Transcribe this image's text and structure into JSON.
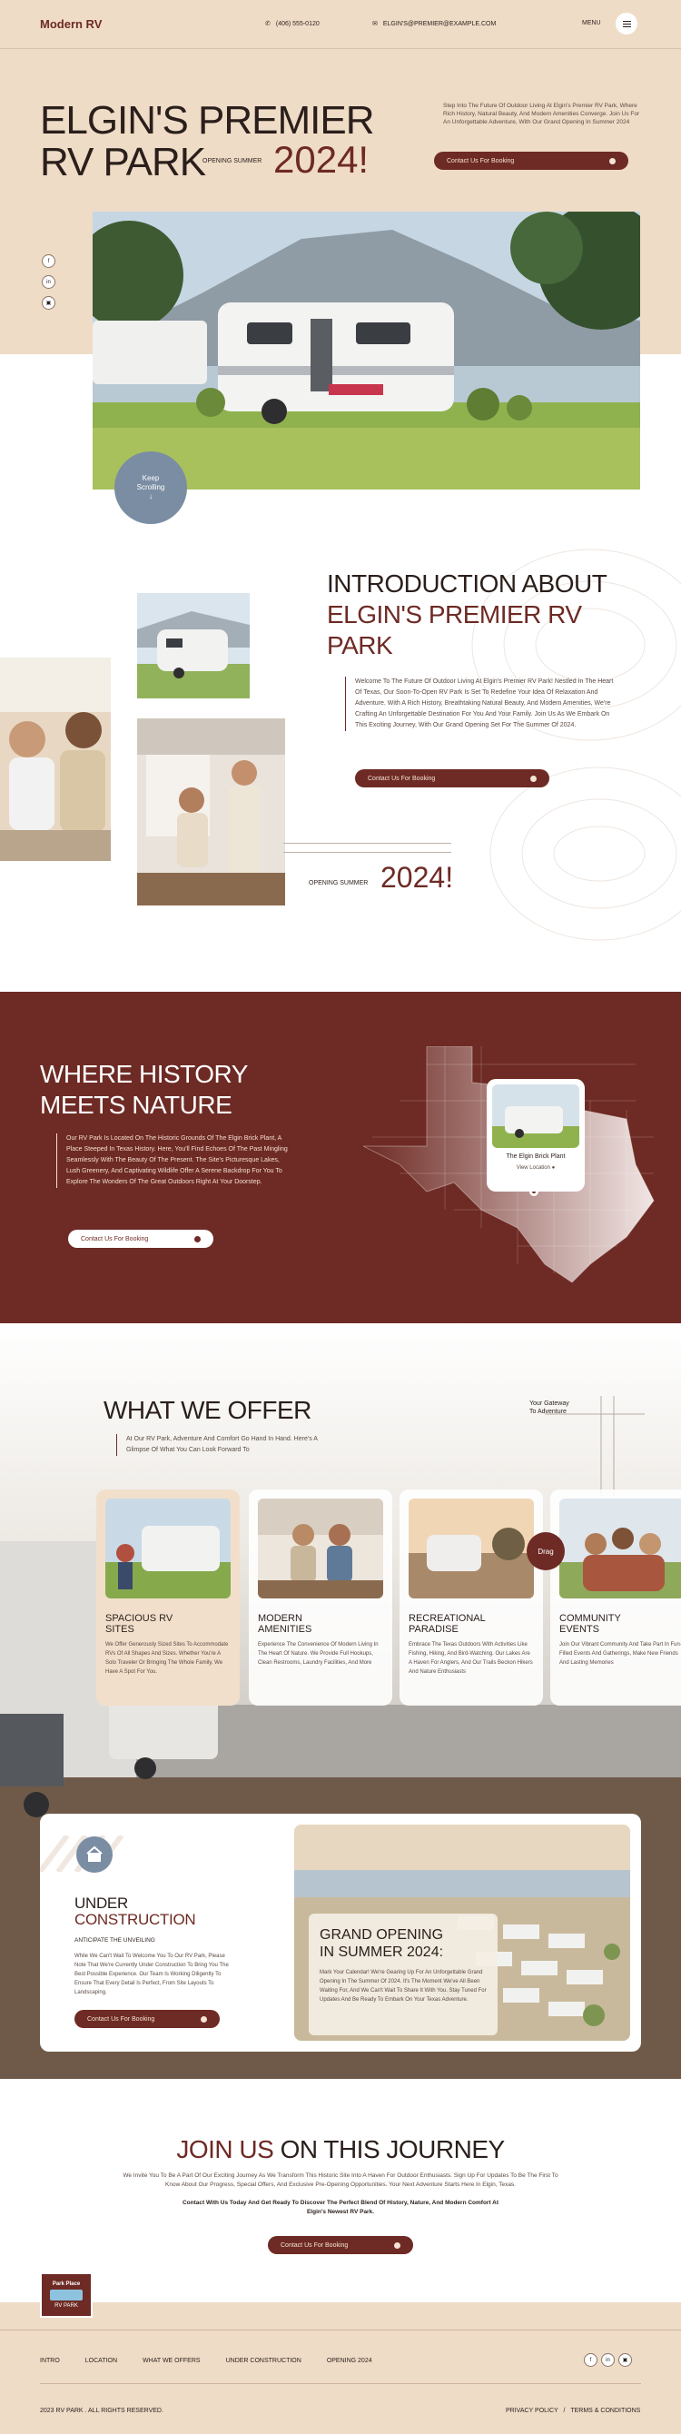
{
  "header": {
    "logo": "Modern RV",
    "phone": "(406) 555-0120",
    "email": "ELGIN'S@PREMIER@EXAMPLE.COM",
    "menu_label": "MENU"
  },
  "hero": {
    "title_line1": "ELGIN'S PREMIER",
    "title_line2": "RV PARK",
    "opening_label": "OPENING SUMMER",
    "year": "2024!",
    "text": "Step Into The Future Of Outdoor Living At Elgin's Premier RV Park, Where Rich History, Natural Beauty, And Modern Amenities Converge. Join Us For An Unforgettable Adventure, With Our Grand Opening In Summer 2024",
    "cta": "Contact Us For Booking",
    "keep_scrolling": "Keep Scrolling"
  },
  "intro": {
    "title_line1": "INTRODUCTION ABOUT",
    "title_line2": "ELGIN'S PREMIER RV",
    "title_line3": "PARK",
    "text": "Welcome To The Future Of Outdoor Living At Elgin's Premier RV Park! Nestled In The Heart Of Texas, Our Soon-To-Open RV Park Is Set To Redefine Your Idea Of Relaxation And Adventure. With A Rich History, Breathtaking Natural Beauty, And Modern Amenities, We're Crafting An Unforgettable Destination For You And Your Family. Join Us As We Embark On This Exciting Journey, With Our Grand Opening Set For The Summer Of 2024.",
    "cta": "Contact Us For Booking",
    "opening_label": "OPENING SUMMER",
    "year": "2024!"
  },
  "history": {
    "title_line1": "WHERE HISTORY",
    "title_line2": "MEETS NATURE",
    "text": "Our RV Park Is Located On The Historic Grounds Of The Elgin Brick Plant, A Place Steeped In Texas History. Here, You'll Find Echoes Of The Past Mingling Seamlessly With The Beauty Of The Present. The Site's Picturesque Lakes, Lush Greenery, And Captivating Wildlife Offer A Serene Backdrop For You To Explore The Wonders Of The Great Outdoors Right At Your Doorstep.",
    "cta": "Contact Us For Booking",
    "place_name": "The Elgin Brick Plant",
    "place_link": "View Location"
  },
  "offer": {
    "title": "WHAT WE OFFER",
    "text": "At Our RV Park, Adventure And Comfort Go Hand In Hand. Here's A Glimpse Of What You Can Look Forward To",
    "gateway_line1": "Your Gateway",
    "gateway_line2": "To Adventure",
    "drag_label": "Drag",
    "cards": [
      {
        "title_line1": "SPACIOUS RV",
        "title_line2": "SITES",
        "text": "We Offer Generously Sized Sites To Accommodate RVs Of All Shapes And Sizes. Whether You're A Solo Traveler Or Bringing The Whole Family, We Have A Spot For You."
      },
      {
        "title_line1": "MODERN",
        "title_line2": "AMENITIES",
        "text": "Experience The Convenience Of Modern Living In The Heart Of Nature. We Provide Full Hookups, Clean Restrooms, Laundry Facilities, And More"
      },
      {
        "title_line1": "RECREATIONAL",
        "title_line2": "PARADISE",
        "text": "Embrace The Texas Outdoors With Activities Like Fishing, Hiking, And Bird-Watching. Our Lakes Are A Haven For Anglers, And Our Trails Beckon Hikers And Nature Enthusiasts"
      },
      {
        "title_line1": "COMMUNITY",
        "title_line2": "EVENTS",
        "text": "Join Our Vibrant Community And Take Part In Fun-Filled Events And Gatherings, Make New Friends And Lasting Memories"
      }
    ]
  },
  "construction": {
    "title_line1": "UNDER",
    "title_line2": "CONSTRUCTION",
    "subtitle": "ANTICIPATE THE UNVEILING",
    "text": "While We Can't Wait To Welcome You To Our RV Park, Please Note That We're Currently Under Construction To Bring You The Best Possible Experience. Our Team Is Working Diligently To Ensure That Every Detail Is Perfect, From Site Layouts To Landscaping.",
    "cta": "Contact Us For Booking",
    "grand_title_line1": "GRAND OPENING",
    "grand_title_line2": "IN SUMMER 2024:",
    "grand_text": "Mark Your Calendar! We're Gearing Up For An Unforgettable Grand Opening In The Summer Of 2024. It's The Moment We've All Been Waiting For, And We Can't Wait To Share It With You. Stay Tuned For Updates And Be Ready To Embark On Your Texas Adventure."
  },
  "join": {
    "title_accent": "JOIN US",
    "title_rest": "ON THIS JOURNEY",
    "text": "We Invite You To Be A Part Of Our Exciting Journey As We Transform This Historic Site Into A Haven For Outdoor Enthusiasts. Sign Up For Updates To Be The First To Know About Our Progress, Special Offers, And Exclusive Pre-Opening Opportunities. Your Next Adventure Starts Here In Elgin, Texas.",
    "bold_text": "Contact With Us Today And Get Ready To Discover The Perfect Blend Of History, Nature, And Modern Comfort At Elgin's Newest RV Park.",
    "cta": "Contact Us For Booking"
  },
  "footer": {
    "badge_line1": "Park Place",
    "badge_line2": "RV PARK",
    "nav": [
      "INTRO",
      "LOCATION",
      "WHAT WE OFFERS",
      "UNDER CONSTRUCTION",
      "OPENING 2024"
    ],
    "copyright": "2023 RV PARK . ALL RIGHTS RESERVED.",
    "privacy": "PRIVACY POLICY",
    "separator": "/",
    "terms": "TERMS & CONDITIONS"
  },
  "social_icons": [
    "facebook-icon",
    "linkedin-icon",
    "instagram-icon"
  ],
  "colors": {
    "accent": "#6e2a24",
    "sand": "#efdcc7",
    "slate": "#7a8da3"
  }
}
